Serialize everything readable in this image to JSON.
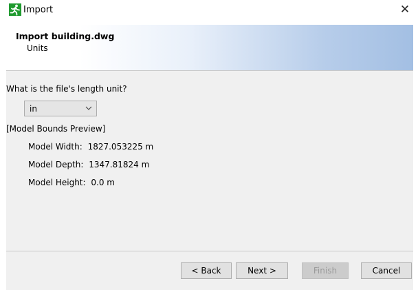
{
  "window": {
    "title": "Import",
    "close_glyph": "✕",
    "icon": "running-man-icon"
  },
  "banner": {
    "title": "Import building.dwg",
    "subtitle": "Units"
  },
  "form": {
    "question": "What is the file's length unit?",
    "unit_select": {
      "value": "in"
    },
    "preview_label": "[Model Bounds Preview]",
    "properties": [
      {
        "label": "Model Width:",
        "value": "1827.053225 m"
      },
      {
        "label": "Model Depth:",
        "value": "1347.81824 m"
      },
      {
        "label": "Model Height:",
        "value": "0.0 m"
      }
    ]
  },
  "buttons": {
    "back": "< Back",
    "next": "Next >",
    "finish": "Finish",
    "cancel": "Cancel"
  },
  "colors": {
    "icon_green": "#1f9a2f",
    "banner_blue": "#a3bfe3",
    "panel_bg": "#f0f0f0"
  }
}
